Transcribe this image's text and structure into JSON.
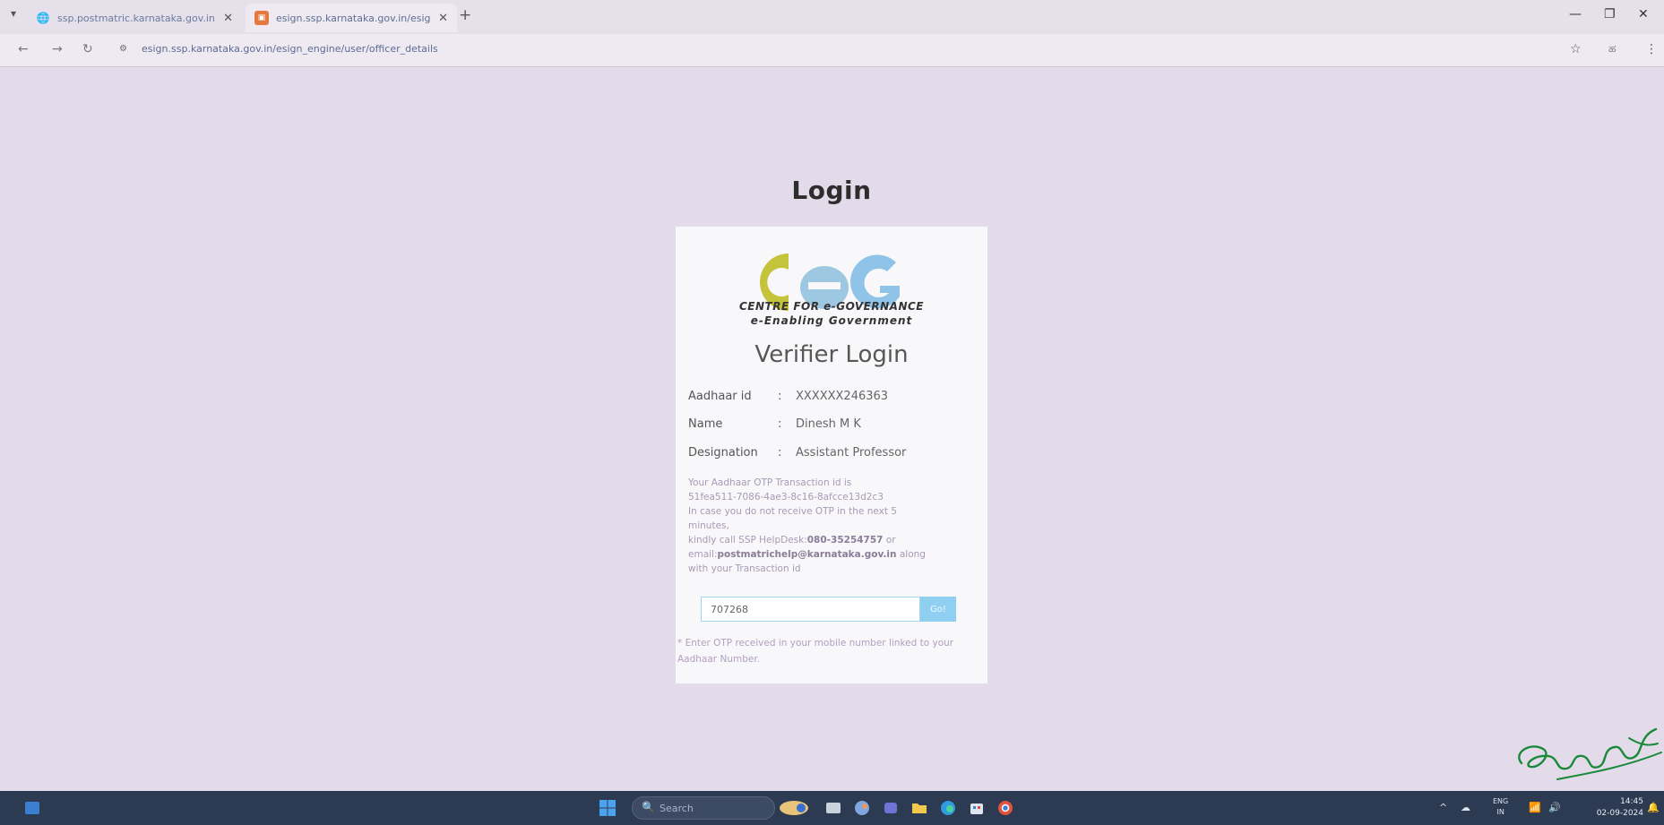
{
  "browser": {
    "tabs": [
      {
        "title": "ssp.postmatric.karnataka.gov.in",
        "active": false
      },
      {
        "title": "esign.ssp.karnataka.gov.in/esig",
        "active": true
      }
    ],
    "url": "esign.ssp.karnataka.gov.in/esign_engine/user/officer_details",
    "profile_label": "ಹ"
  },
  "page": {
    "heading": "Login"
  },
  "card": {
    "logo": {
      "text": "CeG",
      "line1": "CENTRE FOR e-GOVERNANCE",
      "line2": "e-Enabling Government",
      "colors": {
        "c": "#c4c33a",
        "e": "#9ec8e2",
        "g": "#8fc4e8"
      }
    },
    "title": "Verifier Login",
    "fields": [
      {
        "label": "Aadhaar id",
        "value": "XXXXXX246363"
      },
      {
        "label": "Name",
        "value": "Dinesh M K"
      },
      {
        "label": "Designation",
        "value": "Assistant Professor"
      }
    ],
    "separator": ":",
    "notice": {
      "line1": "Your Aadhaar OTP Transaction id is",
      "line2": "51fea511-7086-4ae3-8c16-8afcce13d2c3",
      "line3": "In case you do not receive OTP in the next 5",
      "line4": "minutes,",
      "line5_prefix": "kindly call SSP HelpDesk:",
      "helpdesk": "080-35254757",
      "line5_suffix": " or",
      "line6_prefix": "email:",
      "email": "postmatrichelp@karnataka.gov.in",
      "line6_suffix": " along",
      "line7": "with your Transaction id"
    },
    "otp": {
      "value": "707268",
      "go_label": "Go!"
    },
    "hint": "* Enter OTP received in your mobile number linked to your Aadhaar Number."
  },
  "taskbar": {
    "search_placeholder": "Search",
    "lang_line1": "ENG",
    "lang_line2": "IN",
    "time": "14:45",
    "date": "02-09-2024"
  },
  "colors": {
    "page_bg": "#e3dbe9",
    "taskbar_bg": "#2c3a52",
    "go_button": "#8fd0f2"
  }
}
